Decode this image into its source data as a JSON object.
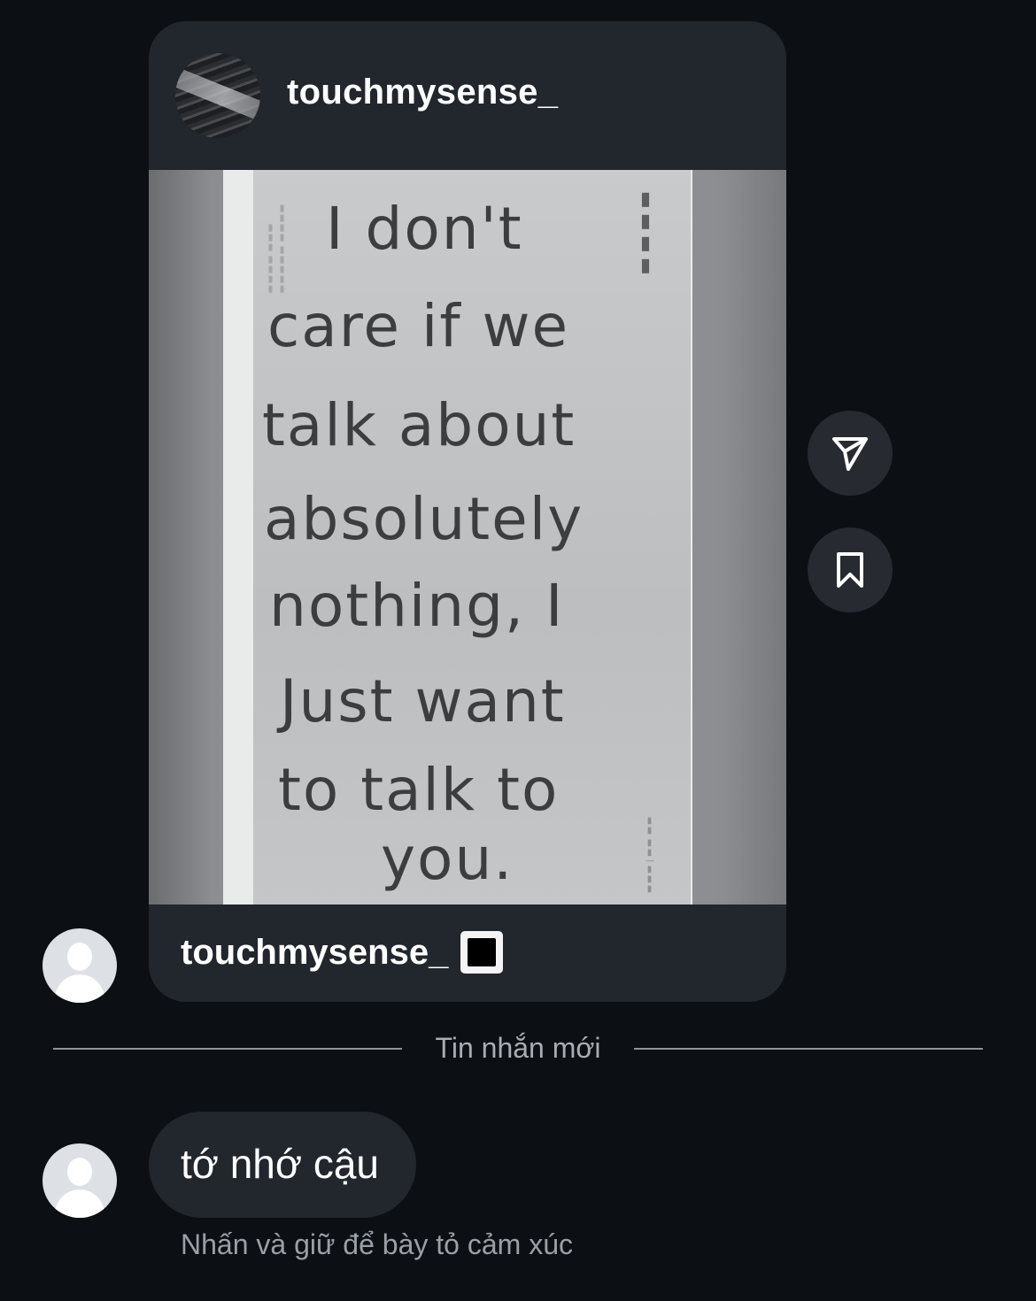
{
  "post": {
    "username": "touchmysense_",
    "caption_username": "touchmysense_",
    "image_note_lines": [
      "I don't",
      "care if we",
      "talk about",
      "absolutely",
      "nothing, I",
      "Just want",
      "to talk to",
      "you."
    ]
  },
  "actions": {
    "share_icon": "paper-plane-icon",
    "save_icon": "bookmark-icon"
  },
  "divider": {
    "label": "Tin nhắn mới"
  },
  "message": {
    "text": "tớ nhớ cậu",
    "hint": "Nhấn và giữ để bày tỏ cảm xúc"
  },
  "colors": {
    "background": "#0c0f14",
    "bubble": "#22262d",
    "button": "#272a30",
    "muted_text": "#9aa0a8"
  }
}
